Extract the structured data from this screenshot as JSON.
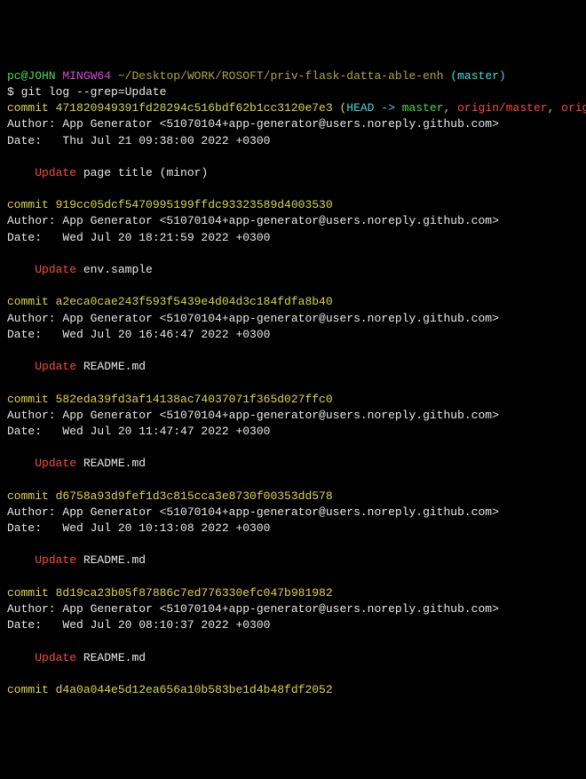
{
  "prompt": {
    "user": "pc@JOHN",
    "env": "MINGW64",
    "path": "~/Desktop/WORK/ROSOFT/priv-flask-datta-able-enh",
    "branch": "master"
  },
  "command": "$ git log --grep=Update",
  "head_refs": {
    "open": " (",
    "head": "HEAD -> ",
    "local": "master",
    "sep1": ", ",
    "remote1": "origin/master",
    "sep2": ", ",
    "remote2": "origin/HEAD",
    "close": ")"
  },
  "commits": [
    {
      "hash": "471820949391fd28294c516bdf62b1cc3120e7e3",
      "author": "Author: App Generator <51070104+app-generator@users.noreply.github.com>",
      "date": "Date:   Thu Jul 21 09:38:00 2022 +0300",
      "msg_kw": "Update",
      "msg_rest": " page title (minor)",
      "has_refs": true
    },
    {
      "hash": "919cc05dcf5470995199ffdc93323589d4003530",
      "author": "Author: App Generator <51070104+app-generator@users.noreply.github.com>",
      "date": "Date:   Wed Jul 20 18:21:59 2022 +0300",
      "msg_kw": "Update",
      "msg_rest": " env.sample"
    },
    {
      "hash": "a2eca0cae243f593f5439e4d04d3c184fdfa8b40",
      "author": "Author: App Generator <51070104+app-generator@users.noreply.github.com>",
      "date": "Date:   Wed Jul 20 16:46:47 2022 +0300",
      "msg_kw": "Update",
      "msg_rest": " README.md"
    },
    {
      "hash": "582eda39fd3af14138ac74037071f365d027ffc0",
      "author": "Author: App Generator <51070104+app-generator@users.noreply.github.com>",
      "date": "Date:   Wed Jul 20 11:47:47 2022 +0300",
      "msg_kw": "Update",
      "msg_rest": " README.md"
    },
    {
      "hash": "d6758a93d9fef1d3c815cca3e8730f00353dd578",
      "author": "Author: App Generator <51070104+app-generator@users.noreply.github.com>",
      "date": "Date:   Wed Jul 20 10:13:08 2022 +0300",
      "msg_kw": "Update",
      "msg_rest": " README.md"
    },
    {
      "hash": "8d19ca23b05f87886c7ed776330efc047b981982",
      "author": "Author: App Generator <51070104+app-generator@users.noreply.github.com>",
      "date": "Date:   Wed Jul 20 08:10:37 2022 +0300",
      "msg_kw": "Update",
      "msg_rest": " README.md"
    },
    {
      "hash": "d4a0a044e5d12ea656a10b583be1d4b48fdf2052",
      "partial": true
    }
  ],
  "commit_label": "commit ",
  "indent": "    "
}
